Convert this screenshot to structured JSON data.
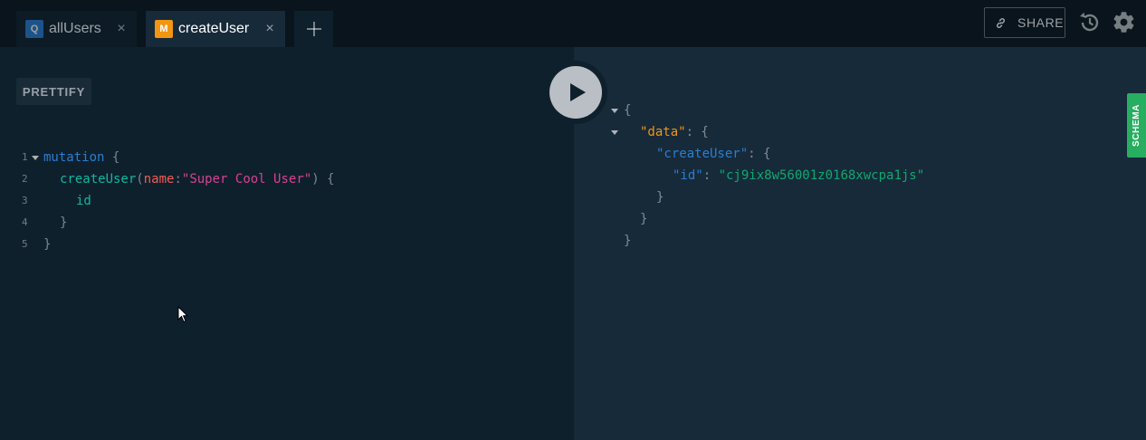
{
  "tabs": [
    {
      "badge": "Q",
      "label": "allUsers",
      "close": "×"
    },
    {
      "badge": "M",
      "label": "createUser",
      "close": "×"
    }
  ],
  "toolbar": {
    "share_label": "SHARE"
  },
  "editor": {
    "prettify_label": "PRETTIFY",
    "line_numbers": [
      "1",
      "2",
      "3",
      "4",
      "5"
    ],
    "lines": {
      "l1_keyword": "mutation",
      "l1_brace": " {",
      "l2_fn": "createUser",
      "l2_open": "(",
      "l2_arg": "name",
      "l2_colon": ":",
      "l2_str": "\"Super Cool User\"",
      "l2_close": ") {",
      "l3_field": "id",
      "l4_brace": "}",
      "l5_brace": "}"
    }
  },
  "result": {
    "open_brace": "{",
    "data_key": "\"data\"",
    "create_key": "\"createUser\"",
    "id_key": "\"id\"",
    "colon_brace": ": {",
    "colon": ": ",
    "id_value": "\"cj9ix8w56001z0168xwcpa1js\"",
    "close_brace": "}"
  },
  "schema_label": "SCHEMA",
  "colors": {
    "background": "#0f202d",
    "result_background": "#172a3a",
    "query_badge": "#2a7ed2",
    "mutation_badge": "#f29513",
    "schema_tab": "#27ae60"
  }
}
